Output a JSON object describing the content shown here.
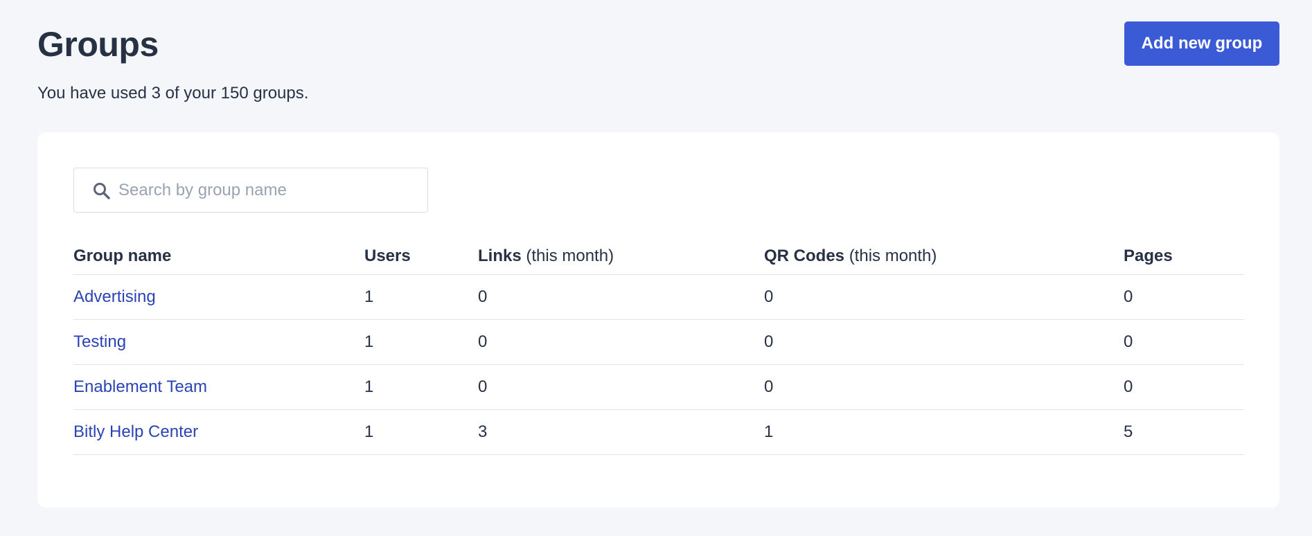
{
  "header": {
    "title": "Groups",
    "add_button_label": "Add new group",
    "usage_text": "You have used 3 of your 150 groups."
  },
  "search": {
    "placeholder": "Search by group name",
    "value": ""
  },
  "table": {
    "columns": [
      {
        "label": "Group name",
        "sub": ""
      },
      {
        "label": "Users",
        "sub": ""
      },
      {
        "label": "Links",
        "sub": "(this month)"
      },
      {
        "label": "QR Codes",
        "sub": "(this month)"
      },
      {
        "label": "Pages",
        "sub": ""
      }
    ],
    "rows": [
      {
        "name": "Advertising",
        "users": "1",
        "links": "0",
        "qr_codes": "0",
        "pages": "0"
      },
      {
        "name": "Testing",
        "users": "1",
        "links": "0",
        "qr_codes": "0",
        "pages": "0"
      },
      {
        "name": "Enablement Team",
        "users": "1",
        "links": "0",
        "qr_codes": "0",
        "pages": "0"
      },
      {
        "name": "Bitly Help Center",
        "users": "1",
        "links": "3",
        "qr_codes": "1",
        "pages": "5"
      }
    ]
  },
  "icons": {
    "search": "search-icon"
  },
  "colors": {
    "background": "#f4f6fa",
    "primary_button": "#3b5bd6",
    "link": "#2a44b8",
    "text": "#273144",
    "placeholder": "#9aa3b2"
  }
}
